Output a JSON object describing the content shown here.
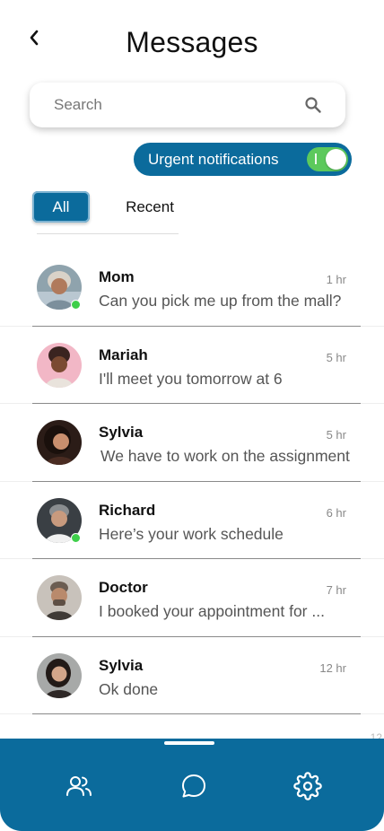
{
  "header": {
    "title": "Messages",
    "back_icon": "chevron-left-icon"
  },
  "search": {
    "placeholder": "Search",
    "value": "",
    "icon": "search-icon"
  },
  "urgent": {
    "label": "Urgent notifications",
    "enabled": true
  },
  "tabs": [
    {
      "label": "All",
      "active": true
    },
    {
      "label": "Recent",
      "active": false
    }
  ],
  "conversations": [
    {
      "name": "Mom",
      "message": "Can you pick me up from the mall?",
      "time": "1 hr",
      "online": true
    },
    {
      "name": "Mariah",
      "message": "I'll meet you tomorrow at 6",
      "time": "5 hr",
      "online": false
    },
    {
      "name": "Sylvia",
      "message": "We have to work on the assignment",
      "time": "5 hr",
      "online": false
    },
    {
      "name": "Richard",
      "message": "Here’s your work schedule",
      "time": "6 hr",
      "online": true
    },
    {
      "name": "Doctor",
      "message": "I booked your appointment for ...",
      "time": "7 hr",
      "online": false
    },
    {
      "name": "Sylvia",
      "message": "Ok done",
      "time": "12 hr",
      "online": false
    }
  ],
  "peek_time": "12",
  "bottom_nav": [
    {
      "icon": "contacts-icon"
    },
    {
      "icon": "chat-icon"
    },
    {
      "icon": "settings-icon"
    }
  ],
  "colors": {
    "primary": "#0b6b9c",
    "toggle_on": "#5cc95c",
    "online": "#3ecf4a"
  }
}
